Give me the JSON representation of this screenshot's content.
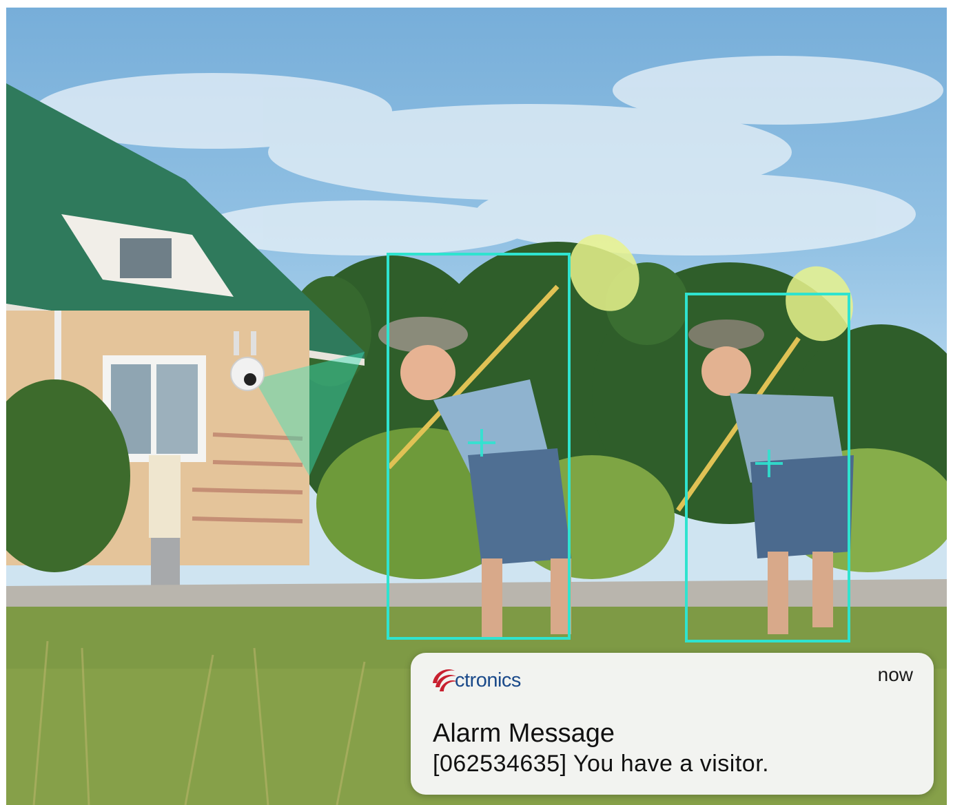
{
  "notification": {
    "brand": "ctronics",
    "time": "now",
    "title": "Alarm Message",
    "message": "[062534635] You have a visitor."
  },
  "detections": [
    {
      "label": "person",
      "subject": "boy-left"
    },
    {
      "label": "person",
      "subject": "boy-right"
    }
  ],
  "colors": {
    "detection_box": "#2fe3cf",
    "roof": "#2f7a5c",
    "brand_red": "#c8202f",
    "brand_blue": "#1b4a8a",
    "notification_bg": "#f7f7f7"
  },
  "icons": {
    "logo": "ctronics-swirl-logo",
    "camera": "security-camera"
  }
}
